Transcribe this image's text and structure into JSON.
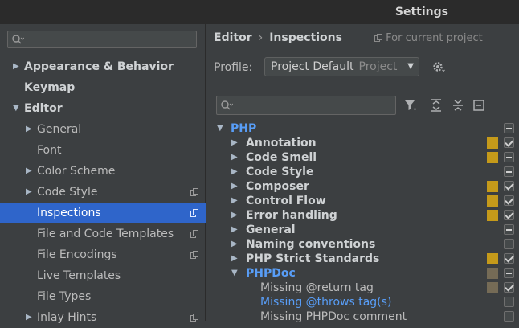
{
  "window": {
    "title": "Settings"
  },
  "sidebar": {
    "search_placeholder": "",
    "items": [
      {
        "label": "Appearance & Behavior",
        "expanded": false
      },
      {
        "label": "Keymap"
      },
      {
        "label": "Editor",
        "expanded": true
      },
      {
        "label": "General"
      },
      {
        "label": "Font"
      },
      {
        "label": "Color Scheme"
      },
      {
        "label": "Code Style"
      },
      {
        "label": "Inspections"
      },
      {
        "label": "File and Code Templates"
      },
      {
        "label": "File Encodings"
      },
      {
        "label": "Live Templates"
      },
      {
        "label": "File Types"
      },
      {
        "label": "Inlay Hints"
      }
    ]
  },
  "main": {
    "breadcrumb": {
      "parent": "Editor",
      "sep": "›",
      "current": "Inspections"
    },
    "for_project": "For current project",
    "profile": {
      "label": "Profile:",
      "value": "Project Default",
      "scope": "Project"
    },
    "inspections": {
      "root": "PHP",
      "groups": [
        {
          "label": "Annotation",
          "severity": "warning",
          "state": "checked"
        },
        {
          "label": "Code Smell",
          "severity": "warning",
          "state": "mixed"
        },
        {
          "label": "Code Style",
          "severity": "",
          "state": "mixed"
        },
        {
          "label": "Composer",
          "severity": "warning",
          "state": "checked"
        },
        {
          "label": "Control Flow",
          "severity": "warning",
          "state": "checked"
        },
        {
          "label": "Error handling",
          "severity": "warning",
          "state": "checked"
        },
        {
          "label": "General",
          "severity": "",
          "state": "mixed"
        },
        {
          "label": "Naming conventions",
          "severity": "",
          "state": "unchecked"
        },
        {
          "label": "PHP Strict Standards",
          "severity": "warning",
          "state": "checked"
        },
        {
          "label": "PHPDoc",
          "severity": "weak",
          "state": "mixed"
        }
      ],
      "phpdoc_items": [
        {
          "label": "Missing @return tag",
          "severity": "weak",
          "state": "checked"
        },
        {
          "label": "Missing @throws tag(s)",
          "severity": "",
          "state": "unchecked"
        },
        {
          "label": "Missing PHPDoc comment",
          "severity": "",
          "state": "unchecked"
        }
      ]
    }
  },
  "colors": {
    "warning": "#c59a1a",
    "weak": "#756b56",
    "selected": "#2f65ca",
    "link": "#589df6"
  }
}
